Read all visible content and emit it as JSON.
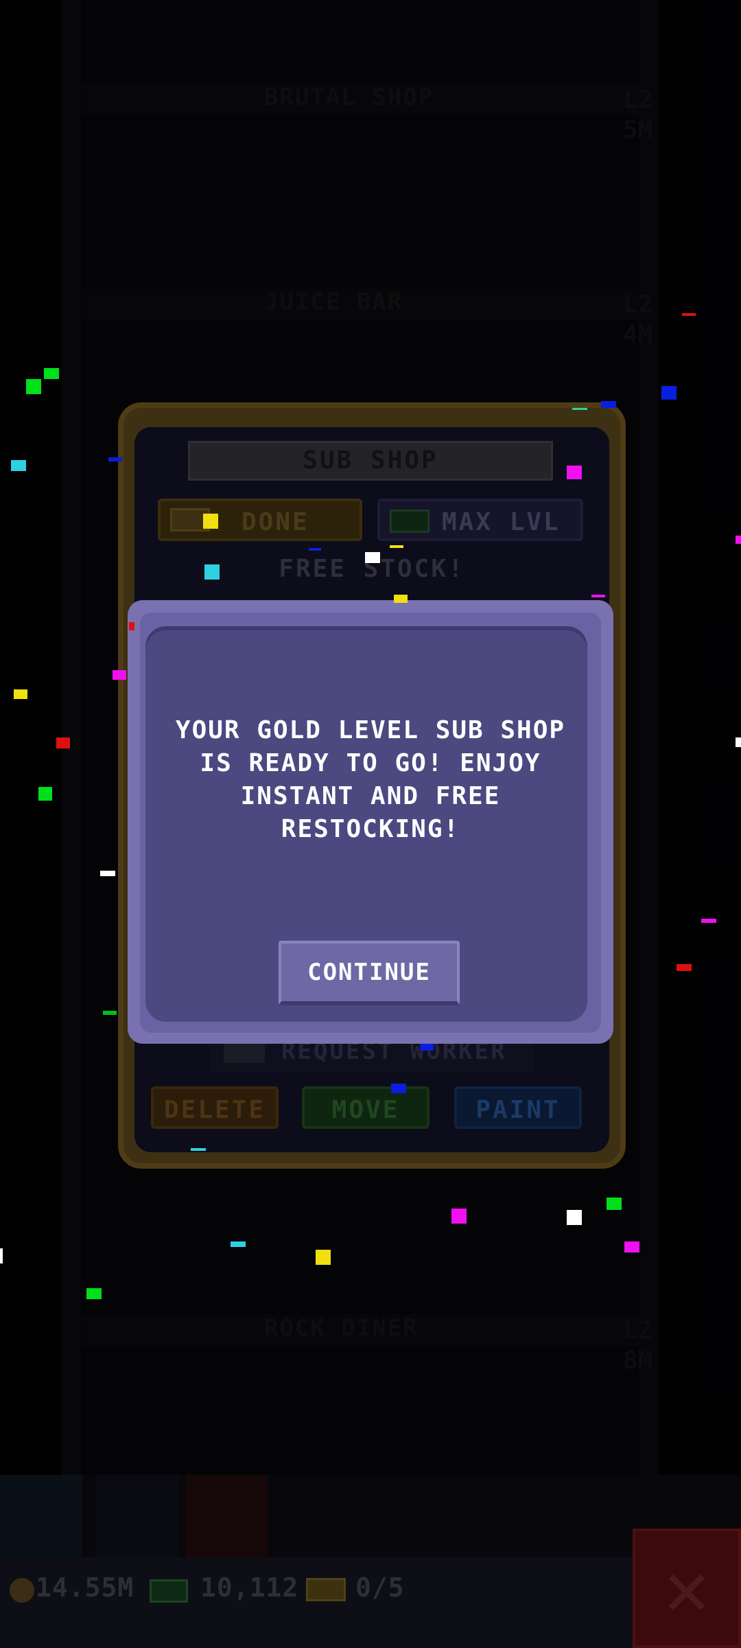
{
  "background": {
    "floors": [
      {
        "name": "BRUTAL SHOP",
        "level": "L2\n5M"
      },
      {
        "name": "JUICE BAR",
        "level": "L2\n4M"
      },
      {
        "name": "ROCK DINER",
        "level": "L2\n8M"
      }
    ]
  },
  "bottom_bar": {
    "coins": "14.55M",
    "bux": "10,112",
    "tickets": "0/5",
    "close_icon": "close-x-icon"
  },
  "shop_panel": {
    "title": "SUB SHOP",
    "done_label": "DONE",
    "max_level_label": "MAX LVL",
    "free_stock_label": "FREE STOCK!",
    "request_worker_label": "REQUEST WORKER",
    "delete_label": "DELETE",
    "move_label": "MOVE",
    "paint_label": "PAINT"
  },
  "modal": {
    "message": "YOUR GOLD LEVEL SUB SHOP IS READY TO GO! ENJOY INSTANT AND FREE RESTOCKING!",
    "continue_label": "CONTINUE"
  },
  "colors": {
    "modal_bg": "#4c4880",
    "modal_border": "#7a72b0",
    "continue_btn": "#6e68a4"
  }
}
